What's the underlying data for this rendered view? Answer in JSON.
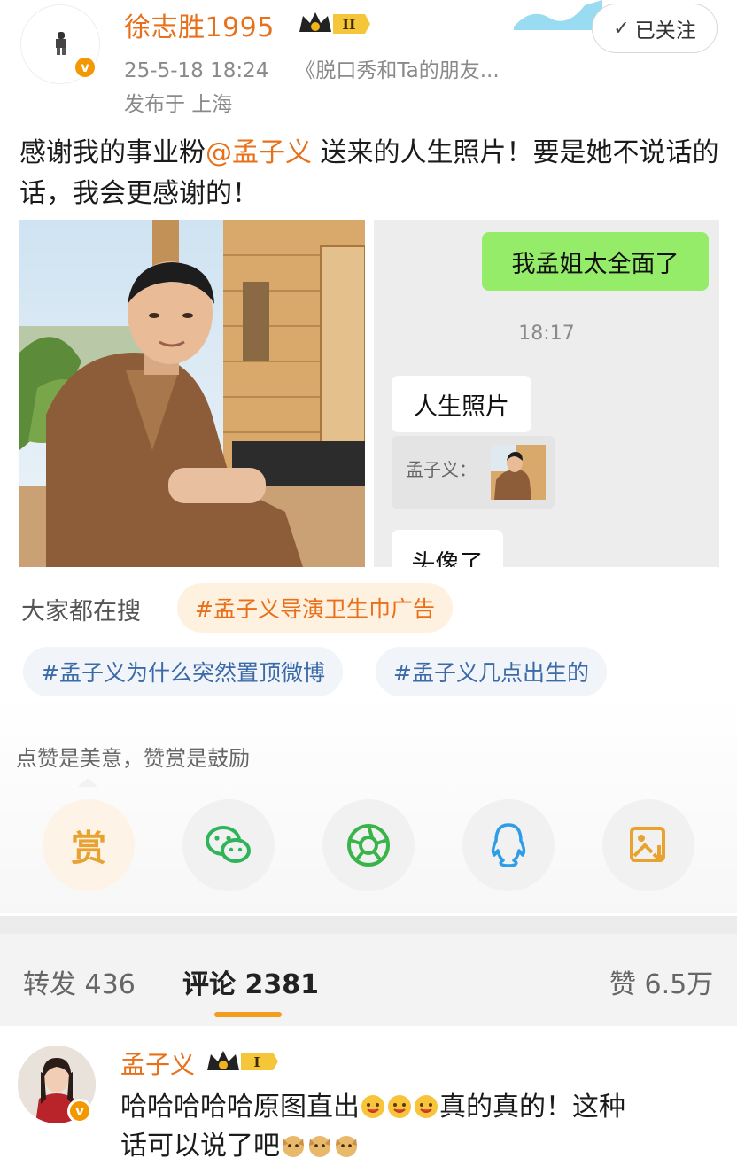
{
  "post": {
    "author": "徐志胜1995",
    "author_level": "II",
    "date": "25-5-18 18:24",
    "source": "《脱口秀和Ta的朋友...",
    "location": "发布于 上海",
    "follow_label": "已关注",
    "text_before": "感谢我的事业粉",
    "mention": "@孟子义",
    "text_after": " 送来的人生照片！要是她不说话的话，我会更感谢的！"
  },
  "chat_image": {
    "green_bubble": "我孟姐太全面了",
    "time": "18:17",
    "white_bubble": "人生照片",
    "quote_label": "孟子义：",
    "last_bubble": "头像了"
  },
  "search": {
    "label": "大家都在搜",
    "tags": [
      "#孟子义导演卫生巾广告",
      "#孟子义为什么突然置顶微博",
      "#孟子义几点出生的"
    ]
  },
  "like_hint": "点赞是美意，赞赏是鼓励",
  "share": {
    "reward_label": "赏",
    "icons": [
      "reward-icon",
      "wechat-icon",
      "moments-icon",
      "qq-icon",
      "save-image-icon"
    ]
  },
  "actions": {
    "repost": "转发 436",
    "comment": "评论 2381",
    "like": "赞 6.5万"
  },
  "comment": {
    "author": "孟子义",
    "author_level": "I",
    "line1_a": "哈哈哈哈哈原图直出",
    "line1_b": "真的真的！这种",
    "line2": "话可以说了吧"
  },
  "colors": {
    "accent_orange": "#e8701a",
    "tab_underline": "#f29d1e",
    "chat_green": "#95ec69",
    "tag_blue": "#3b6aa8"
  }
}
